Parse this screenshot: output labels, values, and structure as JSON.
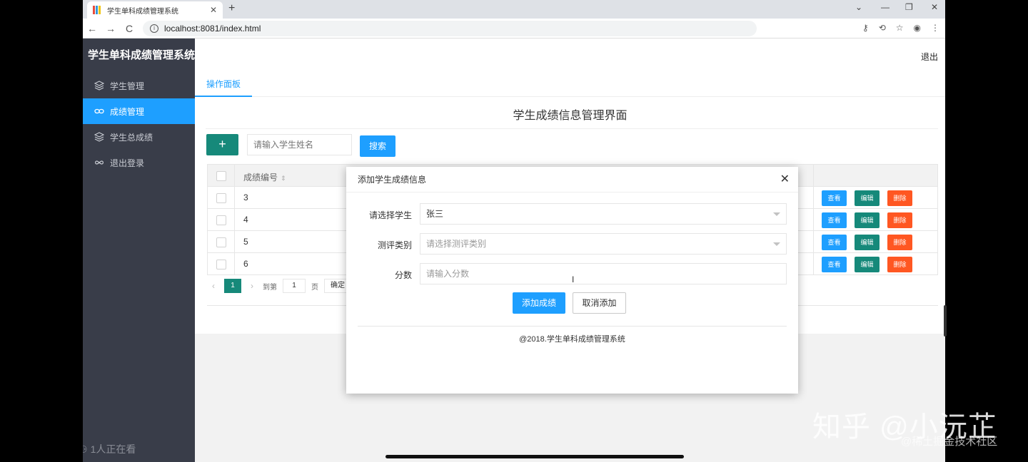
{
  "browser": {
    "tab_title": "学生单科成绩管理系统",
    "new_tab": "+",
    "url": "localhost:8081/index.html",
    "nav": {
      "back": "←",
      "forward": "→",
      "reload": "C"
    }
  },
  "sidebar": {
    "logo": "学生单科成绩管理系统",
    "items": [
      {
        "label": "学生管理",
        "icon": "layers-icon",
        "active": false
      },
      {
        "label": "成绩管理",
        "icon": "link-icon",
        "active": true
      },
      {
        "label": "学生总成绩",
        "icon": "layers-icon",
        "active": false
      },
      {
        "label": "退出登录",
        "icon": "infinity-icon",
        "active": false
      }
    ],
    "watching": "1人正在看"
  },
  "header": {
    "logout": "退出"
  },
  "tabs": {
    "active": "操作面板"
  },
  "panel": {
    "title": "学生成绩信息管理界面",
    "add_button": "+",
    "search_placeholder": "请输入学生姓名",
    "search_button": "搜索"
  },
  "table": {
    "columns": [
      "成绩编号"
    ],
    "rows": [
      {
        "id": "3"
      },
      {
        "id": "4"
      },
      {
        "id": "5"
      },
      {
        "id": "6"
      }
    ],
    "actions": {
      "view": "查看",
      "edit": "编辑",
      "delete": "删除"
    }
  },
  "pager": {
    "current": "1",
    "goto_label": "到第",
    "page_input": "1",
    "page_unit": "页",
    "confirm": "确定"
  },
  "modal": {
    "title": "添加学生成绩信息",
    "close": "✕",
    "fields": {
      "student": {
        "label": "请选择学生",
        "value": "张三"
      },
      "category": {
        "label": "测评类别",
        "placeholder": "请选择测评类别"
      },
      "score": {
        "label": "分数",
        "placeholder": "请输入分数"
      }
    },
    "submit": "添加成绩",
    "cancel": "取消添加",
    "copyright": "@2018.学生单科成绩管理系统"
  },
  "overlay": {
    "watermark": "知乎 @小沅芷",
    "watermark2": "@稀土掘金技术社区"
  },
  "colors": {
    "sidebar_bg": "#393d49",
    "accent_blue": "#1e9fff",
    "accent_green": "#16897a",
    "danger_orange": "#ff5722"
  }
}
